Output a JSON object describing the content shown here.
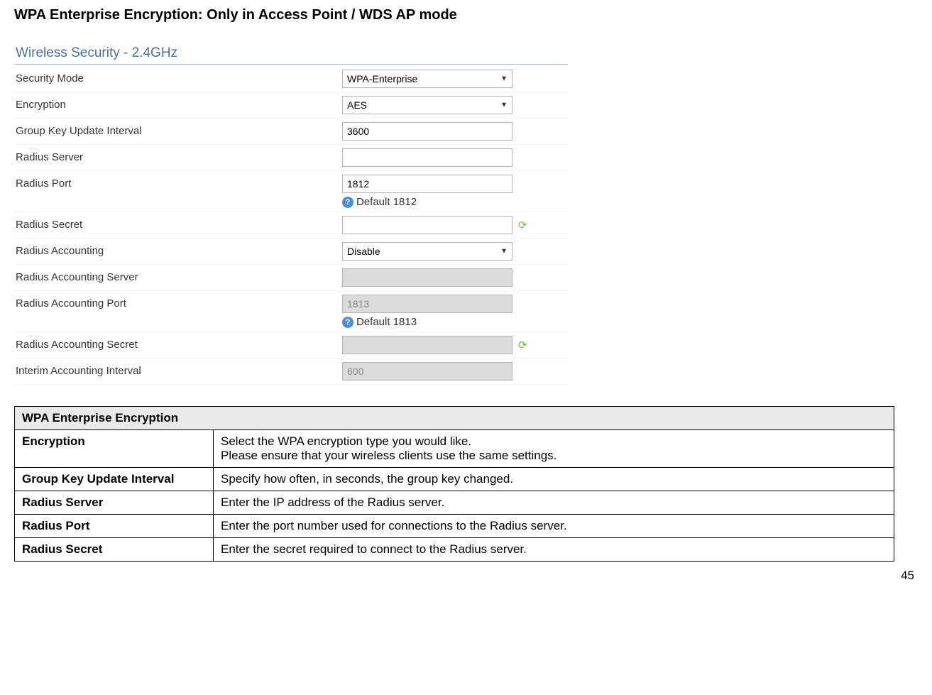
{
  "page_title": "WPA Enterprise Encryption: Only in Access Point / WDS AP mode",
  "panel": {
    "title": "Wireless Security - 2.4GHz",
    "rows": {
      "security_mode": {
        "label": "Security Mode",
        "value": "WPA-Enterprise"
      },
      "encryption": {
        "label": "Encryption",
        "value": "AES"
      },
      "gku_interval": {
        "label": "Group Key Update Interval",
        "value": "3600"
      },
      "radius_server": {
        "label": "Radius Server",
        "value": ""
      },
      "radius_port": {
        "label": "Radius Port",
        "value": "1812",
        "hint": "Default 1812"
      },
      "radius_secret": {
        "label": "Radius Secret",
        "value": ""
      },
      "radius_accounting": {
        "label": "Radius Accounting",
        "value": "Disable"
      },
      "ra_server": {
        "label": "Radius Accounting Server",
        "value": ""
      },
      "ra_port": {
        "label": "Radius Accounting Port",
        "value": "1813",
        "hint": "Default 1813"
      },
      "ra_secret": {
        "label": "Radius Accounting Secret",
        "value": ""
      },
      "interim": {
        "label": "Interim Accounting Interval",
        "value": "600"
      }
    }
  },
  "desc_table": {
    "header": "WPA Enterprise Encryption",
    "rows": [
      {
        "label": "Encryption",
        "text": "Select the WPA encryption type you would like.\nPlease ensure that your wireless clients use the same settings."
      },
      {
        "label": "Group Key Update Interval",
        "text": "Specify how often, in seconds, the group key changed."
      },
      {
        "label": "Radius Server",
        "text": "Enter the IP address of the Radius server."
      },
      {
        "label": "Radius Port",
        "text": "Enter the port number used for connections to the Radius server."
      },
      {
        "label": "Radius Secret",
        "text": "Enter the secret required to connect to the Radius server."
      }
    ]
  },
  "page_number": "45"
}
